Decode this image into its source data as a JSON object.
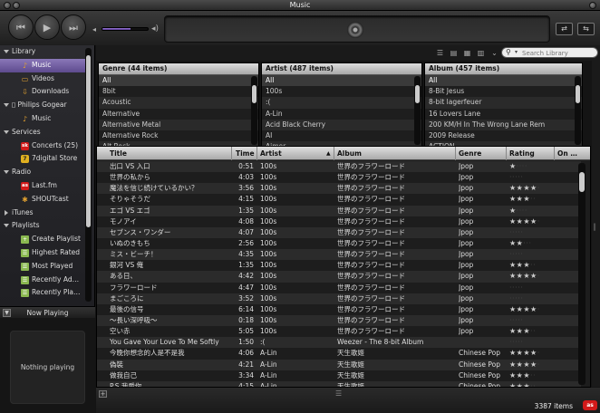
{
  "window": {
    "title": "Music"
  },
  "toolbar": {
    "prev_icon": "⏮",
    "play_icon": "▶",
    "next_icon": "⏭",
    "volume_level": 0.62,
    "search_placeholder": "Search Library"
  },
  "sidebar": {
    "sections": [
      {
        "label": "Library",
        "collapsed": false,
        "items": [
          {
            "label": "Music",
            "icon": "music-note-icon",
            "glyph": "♪",
            "selected": true
          },
          {
            "label": "Videos",
            "icon": "video-icon",
            "glyph": "▭"
          },
          {
            "label": "Downloads",
            "icon": "download-icon",
            "glyph": "⇩"
          }
        ]
      },
      {
        "label": "Philips Gogear",
        "device": true,
        "collapsed": false,
        "items": [
          {
            "label": "Music",
            "icon": "music-note-icon",
            "glyph": "♪"
          }
        ]
      },
      {
        "label": "Services",
        "collapsed": false,
        "items": [
          {
            "label": "Concerts (25)",
            "icon": "songkick-icon",
            "glyph": "sk"
          },
          {
            "label": "7digital Store",
            "icon": "7digital-icon",
            "glyph": "7"
          }
        ]
      },
      {
        "label": "Radio",
        "collapsed": false,
        "items": [
          {
            "label": "Last.fm",
            "icon": "lastfm-icon",
            "glyph": "as"
          },
          {
            "label": "SHOUTcast",
            "icon": "shoutcast-icon",
            "glyph": "✱"
          }
        ]
      },
      {
        "label": "iTunes",
        "collapsed": true,
        "items": []
      },
      {
        "label": "Playlists",
        "collapsed": false,
        "items": [
          {
            "label": "Create Playlist",
            "icon": "add-playlist-icon",
            "glyph": "+"
          },
          {
            "label": "Highest Rated",
            "icon": "smart-playlist-icon",
            "glyph": "☰"
          },
          {
            "label": "Most Played",
            "icon": "smart-playlist-icon",
            "glyph": "☰"
          },
          {
            "label": "Recently Ad…",
            "icon": "smart-playlist-icon",
            "glyph": "☰"
          },
          {
            "label": "Recently Pla…",
            "icon": "smart-playlist-icon",
            "glyph": "☰"
          }
        ]
      }
    ]
  },
  "now_playing": {
    "title": "Now Playing",
    "empty_text": "Nothing playing"
  },
  "browser": {
    "genre": {
      "header": "Genre (44 items)",
      "items": [
        "All",
        "8bit",
        "Acoustic",
        "Alternative",
        "Alternative Metal",
        "Alternative Rock",
        "Alt Rock"
      ]
    },
    "artist": {
      "header": "Artist (487 items)",
      "items": [
        "All",
        "100s",
        ":(",
        "A-Lin",
        "Acid Black Cherry",
        "AI",
        "Aimer"
      ]
    },
    "album": {
      "header": "Album (457 items)",
      "items": [
        "All",
        "8-Bit Jesus",
        "8-bit lagerfeuer",
        "16 Lovers Lane",
        "200 KM/H In The Wrong Lane Rem",
        "2009 Release",
        "ACTION"
      ]
    }
  },
  "tracks": {
    "columns": [
      "Title",
      "Time",
      "Artist",
      "Album",
      "Genre",
      "Rating",
      "On …"
    ],
    "rows": [
      {
        "title": "出口 VS 入口",
        "time": "0:51",
        "artist": "100s",
        "album": "世界のフラワーロード",
        "genre": "Jpop",
        "rating": 1
      },
      {
        "title": "世界の私から",
        "time": "4:03",
        "artist": "100s",
        "album": "世界のフラワーロード",
        "genre": "Jpop",
        "rating": 0
      },
      {
        "title": "魔法を信じ続けているかい？",
        "time": "3:56",
        "artist": "100s",
        "album": "世界のフラワーロード",
        "genre": "Jpop",
        "rating": 4
      },
      {
        "title": "そりゃそうだ",
        "time": "4:15",
        "artist": "100s",
        "album": "世界のフラワーロード",
        "genre": "Jpop",
        "rating": 3
      },
      {
        "title": "エゴ VS エゴ",
        "time": "1:35",
        "artist": "100s",
        "album": "世界のフラワーロード",
        "genre": "Jpop",
        "rating": 1
      },
      {
        "title": "モノアイ",
        "time": "4:08",
        "artist": "100s",
        "album": "世界のフラワーロード",
        "genre": "Jpop",
        "rating": 4
      },
      {
        "title": "セブンス・ワンダー",
        "time": "4:07",
        "artist": "100s",
        "album": "世界のフラワーロード",
        "genre": "Jpop",
        "rating": 0
      },
      {
        "title": "いぬのきもち",
        "time": "2:56",
        "artist": "100s",
        "album": "世界のフラワーロード",
        "genre": "Jpop",
        "rating": 2
      },
      {
        "title": "ミス・ビーチ！",
        "time": "4:35",
        "artist": "100s",
        "album": "世界のフラワーロード",
        "genre": "Jpop",
        "rating": 0
      },
      {
        "title": "銀河 VS 俺",
        "time": "1:35",
        "artist": "100s",
        "album": "世界のフラワーロード",
        "genre": "Jpop",
        "rating": 3
      },
      {
        "title": "ある日、",
        "time": "4:42",
        "artist": "100s",
        "album": "世界のフラワーロード",
        "genre": "Jpop",
        "rating": 4
      },
      {
        "title": "フラワーロード",
        "time": "4:47",
        "artist": "100s",
        "album": "世界のフラワーロード",
        "genre": "Jpop",
        "rating": 0
      },
      {
        "title": "まごころに",
        "time": "3:52",
        "artist": "100s",
        "album": "世界のフラワーロード",
        "genre": "Jpop",
        "rating": 0
      },
      {
        "title": "最後の信号",
        "time": "6:14",
        "artist": "100s",
        "album": "世界のフラワーロード",
        "genre": "Jpop",
        "rating": 4
      },
      {
        "title": "～長い深呼吸～",
        "time": "0:18",
        "artist": "100s",
        "album": "世界のフラワーロード",
        "genre": "Jpop",
        "rating": 0
      },
      {
        "title": "空い赤",
        "time": "5:05",
        "artist": "100s",
        "album": "世界のフラワーロード",
        "genre": "Jpop",
        "rating": 3
      },
      {
        "title": "You Gave Your Love To Me Softly",
        "time": "1:50",
        "artist": ":(",
        "album": "Weezer - The 8-bit Album",
        "genre": "",
        "rating": 0
      },
      {
        "title": "今晚你想念的人是不是我",
        "time": "4:06",
        "artist": "A-Lin",
        "album": "天生歌姬",
        "genre": "Chinese Pop",
        "rating": 4
      },
      {
        "title": "偽裝",
        "time": "4:21",
        "artist": "A-Lin",
        "album": "天生歌姬",
        "genre": "Chinese Pop",
        "rating": 4
      },
      {
        "title": "做我自己",
        "time": "3:34",
        "artist": "A-Lin",
        "album": "天生歌姬",
        "genre": "Chinese Pop",
        "rating": 3
      },
      {
        "title": "P.S.我愛你",
        "time": "4:15",
        "artist": "A-Lin",
        "album": "天生歌姬",
        "genre": "Chinese Pop",
        "rating": 3
      }
    ]
  },
  "status": {
    "item_count": "3387 items",
    "badge": "as"
  },
  "colors": {
    "accent": "#7d6aae",
    "background": "#1d1d1d",
    "lastfm_red": "#d21a1a"
  }
}
